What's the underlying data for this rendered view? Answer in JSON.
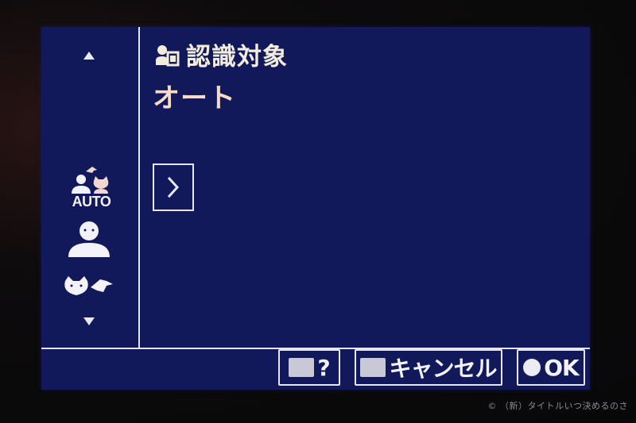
{
  "header": {
    "title": "認識対象",
    "title_icon": "subject-detection-icon"
  },
  "current_value": "オート",
  "sidebar": {
    "options": [
      {
        "name": "auto-detection",
        "label": "AUTO",
        "icon": "person-and-animal-auto-icon"
      },
      {
        "name": "person",
        "icon": "person-icon"
      },
      {
        "name": "animal-bird",
        "icon": "cat-and-bird-icon"
      }
    ]
  },
  "footer": {
    "help_label": "?",
    "cancel_label": "キャンセル",
    "ok_label": "OK"
  },
  "watermark": "© （新）タイトルいつ決めるのさ",
  "colors": {
    "screen_bg": "#12195a",
    "line": "#e6e6f2",
    "title_text": "#f2ecdc",
    "value_text": "#f6dcc4"
  }
}
